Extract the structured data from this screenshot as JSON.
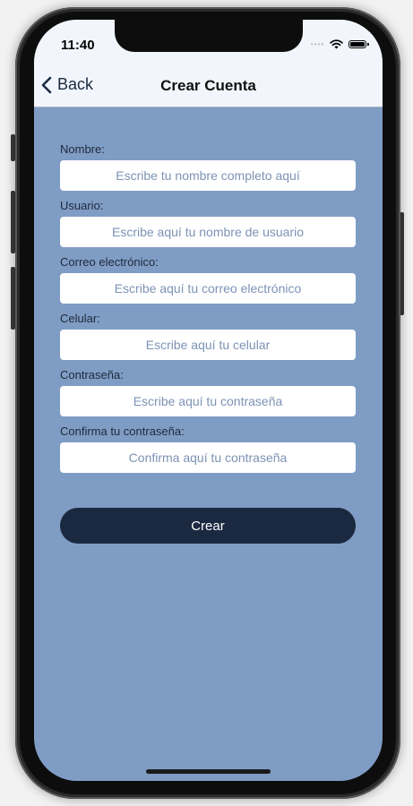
{
  "status_bar": {
    "time": "11:40",
    "signal_icon": "signal-icon",
    "wifi_icon": "wifi-icon",
    "battery_icon": "battery-icon"
  },
  "nav": {
    "back_label": "Back",
    "back_icon": "chevron-left-icon",
    "title": "Crear Cuenta"
  },
  "form": {
    "fields": [
      {
        "label": "Nombre:",
        "placeholder": "Escribe tu nombre completo aquí",
        "value": ""
      },
      {
        "label": "Usuario:",
        "placeholder": "Escribe aquí tu nombre de usuario",
        "value": ""
      },
      {
        "label": "Correo electrónico:",
        "placeholder": "Escribe aquí tu correo electrónico",
        "value": ""
      },
      {
        "label": "Celular:",
        "placeholder": "Escribe aquí tu celular",
        "value": ""
      },
      {
        "label": "Contraseña:",
        "placeholder": "Escribe aquí tu contraseña",
        "value": ""
      },
      {
        "label": "Confirma tu contraseña:",
        "placeholder": "Confirma aquí tu contraseña",
        "value": ""
      }
    ],
    "submit_label": "Crear"
  },
  "colors": {
    "background": "#7f9cc4",
    "nav_background": "#f2f6fc",
    "button_background": "#1b2940",
    "placeholder": "#7d93b5"
  }
}
